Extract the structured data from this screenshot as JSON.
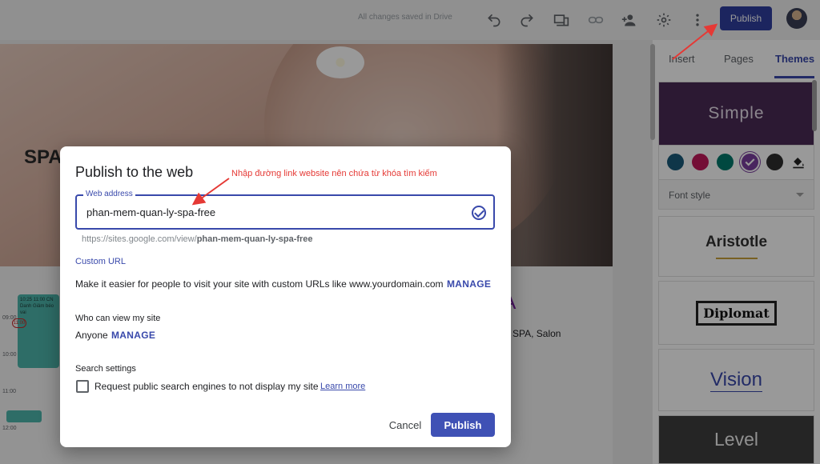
{
  "topbar": {
    "saved_status": "All changes saved in Drive",
    "publish_label": "Publish",
    "icons": [
      "undo-icon",
      "redo-icon",
      "preview-devices-icon",
      "link-icon",
      "add-person-icon",
      "settings-gear-icon",
      "more-vert-icon"
    ]
  },
  "canvas": {
    "hero_title": "SPA",
    "calendar_times": [
      "09:00",
      "10:00",
      "11:00",
      "12:00"
    ],
    "event_text": "10:25 11:00 CN Danh Giảm béo vai",
    "event_mark": "11:00",
    "heading_fragment": "A",
    "body_fragment": "SPA, Salon"
  },
  "panel": {
    "tabs": [
      {
        "label": "Insert",
        "active": false
      },
      {
        "label": "Pages",
        "active": false
      },
      {
        "label": "Themes",
        "active": true
      }
    ],
    "themes": {
      "simple": "Simple",
      "aristotle": "Aristotle",
      "diplomat": "Diplomat",
      "vision": "Vision",
      "level": "Level"
    },
    "swatches": [
      "#1a5a7a",
      "#c2185b",
      "#00796b",
      "#7b3f9e",
      "#2e2e2e"
    ],
    "selected_swatch": 3,
    "font_style_label": "Font style"
  },
  "dialog": {
    "title": "Publish to the web",
    "annotation": "Nhập đường link website nên chứa từ khóa tìm kiếm",
    "web_address_label": "Web address",
    "web_address_value": "phan-mem-quan-ly-spa-free",
    "url_prefix": "https://sites.google.com/view/",
    "url_slug": "phan-mem-quan-ly-spa-free",
    "custom_url_heading": "Custom URL",
    "custom_url_text": "Make it easier for people to visit your site with custom URLs like www.yourdomain.com",
    "manage_label": "MANAGE",
    "who_can_view_heading": "Who can view my site",
    "who_can_view_value": "Anyone",
    "search_settings_heading": "Search settings",
    "search_checkbox_label": "Request public search engines to not display my site",
    "search_checkbox_checked": false,
    "learn_more": "Learn more",
    "cancel_label": "Cancel",
    "publish_label": "Publish"
  },
  "colors": {
    "accent": "#3949ab",
    "annotation_red": "#e53935",
    "publish_button": "#303f9f"
  }
}
